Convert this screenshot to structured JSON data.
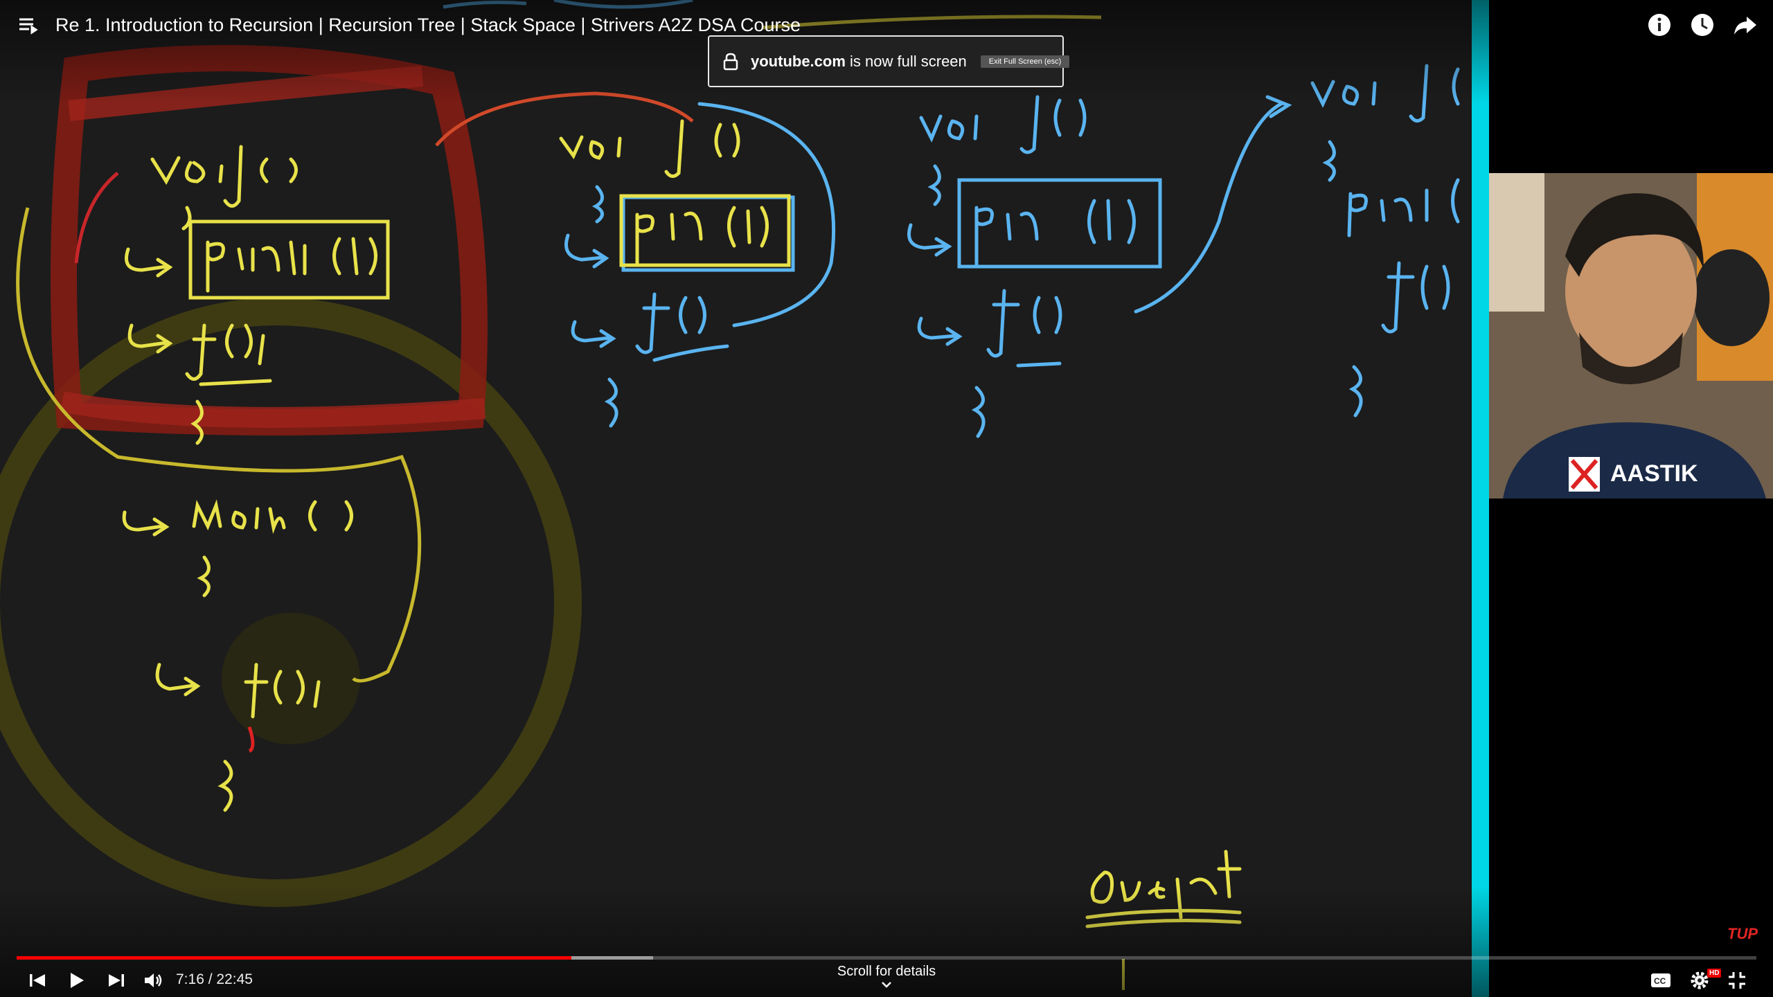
{
  "video": {
    "title": "Re 1. Introduction to Recursion | Recursion Tree | Stack Space | Strivers A2Z DSA Course"
  },
  "fullscreen_toast": {
    "domain": "youtube.com",
    "message": "is now full screen",
    "exit_label": "Exit Full Screen (esc)"
  },
  "player": {
    "time_display": "7:16 / 22:45",
    "progress_fraction": 0.319,
    "buffered_fraction": 0.366,
    "scroll_hint": "Scroll for details",
    "hd_badge": "HD",
    "watermark": "TUP"
  },
  "whiteboard": {
    "code_left": [
      "void f()",
      "{",
      "print(1)",
      "f();",
      "}"
    ],
    "main_block": [
      "main()",
      "{",
      "f();",
      "}"
    ],
    "call_2": [
      "void f()",
      "{",
      "print(1)",
      "f()",
      "}"
    ],
    "call_3": [
      "void f()",
      "{",
      "print(1)",
      "f()",
      "}"
    ],
    "call_4": [
      "void f()",
      "{",
      "print(",
      "f()",
      "}"
    ],
    "output_label": "Output"
  },
  "webcam": {
    "shirt_text": "AASTIK"
  },
  "icons": {
    "menu": "playlist-menu-icon",
    "info": "info-icon",
    "watch_later": "clock-icon",
    "share": "share-icon",
    "prev": "previous-icon",
    "play": "play-icon",
    "next": "next-icon",
    "volume": "volume-icon",
    "captions": "captions-icon",
    "settings": "settings-gear-icon",
    "exit_fullscreen": "exit-fullscreen-icon",
    "lock": "lock-icon"
  },
  "colors": {
    "progress": "#ff0000",
    "accent_cyan": "#00d7e6",
    "chalk_yellow": "#e8e24a",
    "chalk_blue": "#5ab4f0",
    "marker_red": "#b3241b"
  }
}
